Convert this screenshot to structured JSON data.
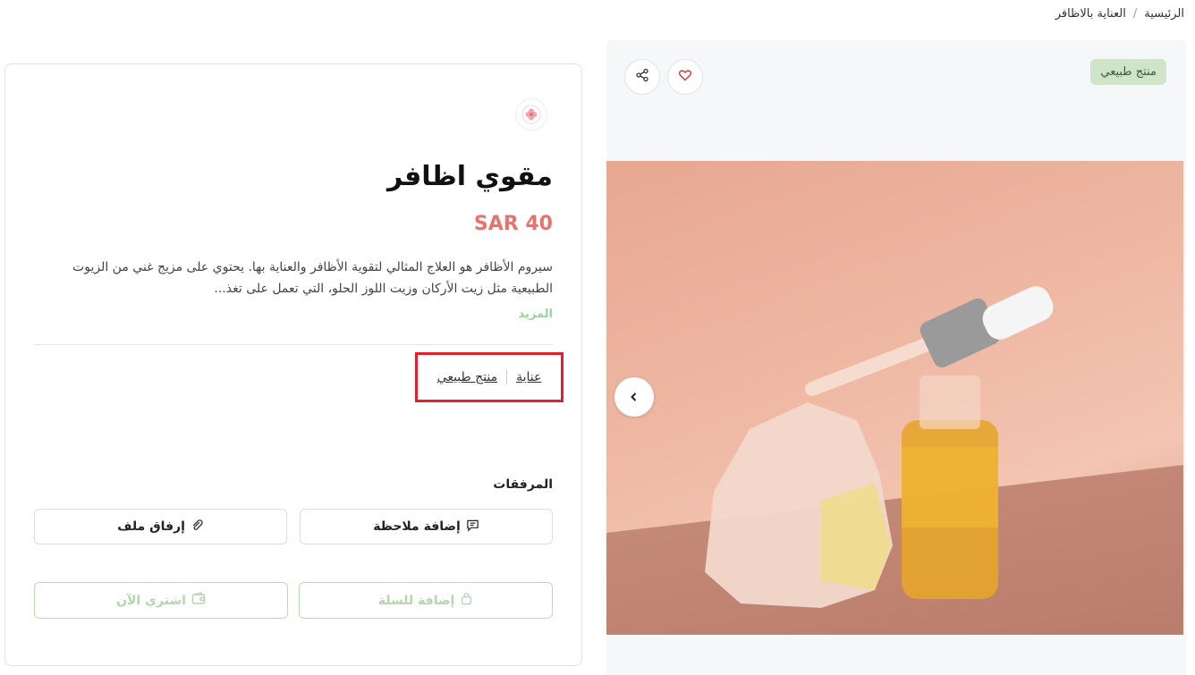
{
  "breadcrumb": {
    "home": "الرئيسية",
    "separator": "/",
    "current": "العناية بالاظافر"
  },
  "gallery": {
    "badge": "منتج طبيعي",
    "share_icon": "share-icon",
    "favorite_icon": "heart-icon",
    "prev_icon": "chevron-left-icon"
  },
  "product": {
    "title": "مقوي اظافر",
    "price": "SAR 40",
    "description": "سيروم الأظافر هو العلاج المثالي لتقوية الأظافر والعناية بها. يحتوي على مزيج غني من الزيوت الطبيعية مثل زيت الأركان وزيت اللوز الحلو، التي تعمل على تغذ...",
    "more_label": "المزيد",
    "tags": [
      "عناية",
      "منتج طبيعي"
    ]
  },
  "attachments": {
    "title": "المرفقات",
    "add_note_label": "إضافة ملاحظة",
    "attach_file_label": "إرفاق ملف"
  },
  "actions": {
    "add_to_cart_label": "إضافة للسلة",
    "buy_now_label": "اشتري الآن"
  },
  "colors": {
    "price": "#e8736d",
    "accent_green": "#a3cf9f",
    "highlight": "#e0202c"
  }
}
